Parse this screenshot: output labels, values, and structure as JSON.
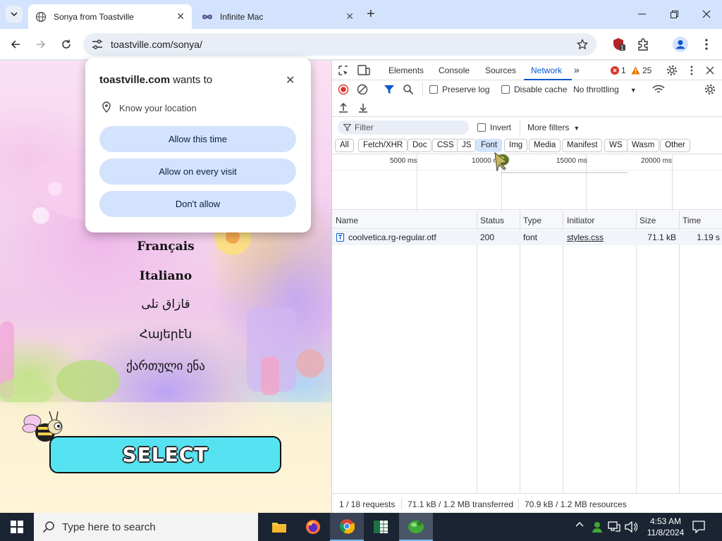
{
  "browser": {
    "tabs": [
      {
        "title": "Sonya from Toastville",
        "active": true
      },
      {
        "title": "Infinite Mac",
        "active": false
      }
    ],
    "address": "toastville.com/sonya/"
  },
  "page": {
    "languages": [
      "Français",
      "Italiano",
      "قازاق تلی",
      "Հայերէն",
      "ქართული ენა"
    ],
    "select_label": "SELECT"
  },
  "permission_prompt": {
    "site": "toastville.com",
    "wants_to": "wants to",
    "permission": "Know your location",
    "buttons": [
      "Allow this time",
      "Allow on every visit",
      "Don't allow"
    ]
  },
  "devtools": {
    "tabs": [
      "Elements",
      "Console",
      "Sources",
      "Network"
    ],
    "active_tab": "Network",
    "errors": "1",
    "warnings": "25",
    "preserve_log": "Preserve log",
    "disable_cache": "Disable cache",
    "throttling": "No throttling",
    "filter_placeholder": "Filter",
    "invert": "Invert",
    "more_filters": "More filters",
    "type_filters": [
      "All",
      "Fetch/XHR",
      "Doc",
      "CSS",
      "JS",
      "Font",
      "Img",
      "Media",
      "Manifest",
      "WS",
      "Wasm",
      "Other"
    ],
    "active_filter": "Font",
    "timeline_ticks": [
      "5000 ms",
      "10000 ms",
      "15000 ms",
      "20000 ms"
    ],
    "columns": [
      "Name",
      "Status",
      "Type",
      "Initiator",
      "Size",
      "Time"
    ],
    "rows": [
      {
        "name": "coolvetica.rg-regular.otf",
        "status": "200",
        "type": "font",
        "initiator": "styles.css",
        "size": "71.1 kB",
        "time": "1.19 s"
      }
    ],
    "summary": [
      "1 / 18 requests",
      "71.1 kB / 1.2 MB transferred",
      "70.9 kB / 1.2 MB resources"
    ]
  },
  "taskbar": {
    "search_placeholder": "Type here to search",
    "time": "4:53 AM",
    "date": "11/8/2024"
  },
  "colors": {
    "tabstrip": "#d3e3fd",
    "accent": "#0b57d0",
    "select_button": "#55e3f2",
    "taskbar": "#1b2433"
  }
}
